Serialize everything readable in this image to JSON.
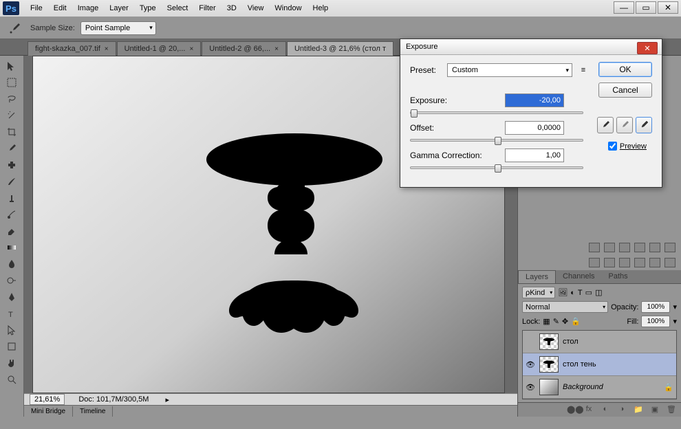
{
  "menubar": {
    "items": [
      "File",
      "Edit",
      "Image",
      "Layer",
      "Type",
      "Select",
      "Filter",
      "3D",
      "View",
      "Window",
      "Help"
    ]
  },
  "optionsbar": {
    "sample_label": "Sample Size:",
    "sample_value": "Point Sample"
  },
  "tabs": [
    {
      "label": "fight-skazka_007.tif",
      "active": false
    },
    {
      "label": "Untitled-1 @ 20,...",
      "active": false
    },
    {
      "label": "Untitled-2 @ 66,...",
      "active": false
    },
    {
      "label": "Untitled-3 @ 21,6% (стол т",
      "active": true
    }
  ],
  "status": {
    "zoom": "21,61%",
    "doc": "Doc: 101,7M/300,5M"
  },
  "bottom_tabs": [
    "Mini Bridge",
    "Timeline"
  ],
  "layers_panel": {
    "tabs": [
      "Layers",
      "Channels",
      "Paths"
    ],
    "kind_label": "Kind",
    "blend": "Normal",
    "opacity_label": "Opacity:",
    "opacity_value": "100%",
    "lock_label": "Lock:",
    "fill_label": "Fill:",
    "fill_value": "100%",
    "layers": [
      {
        "name": "стол",
        "visible": false,
        "bg": false,
        "selected": false
      },
      {
        "name": "стол тень",
        "visible": true,
        "bg": false,
        "selected": true
      },
      {
        "name": "Background",
        "visible": true,
        "bg": true,
        "selected": false
      }
    ]
  },
  "dialog": {
    "title": "Exposure",
    "preset_label": "Preset:",
    "preset_value": "Custom",
    "ok": "OK",
    "cancel": "Cancel",
    "exposure_label": "Exposure:",
    "exposure_value": "-20,00",
    "offset_label": "Offset:",
    "offset_value": "0,0000",
    "gamma_label": "Gamma Correction:",
    "gamma_value": "1,00",
    "preview_label": "Preview"
  }
}
